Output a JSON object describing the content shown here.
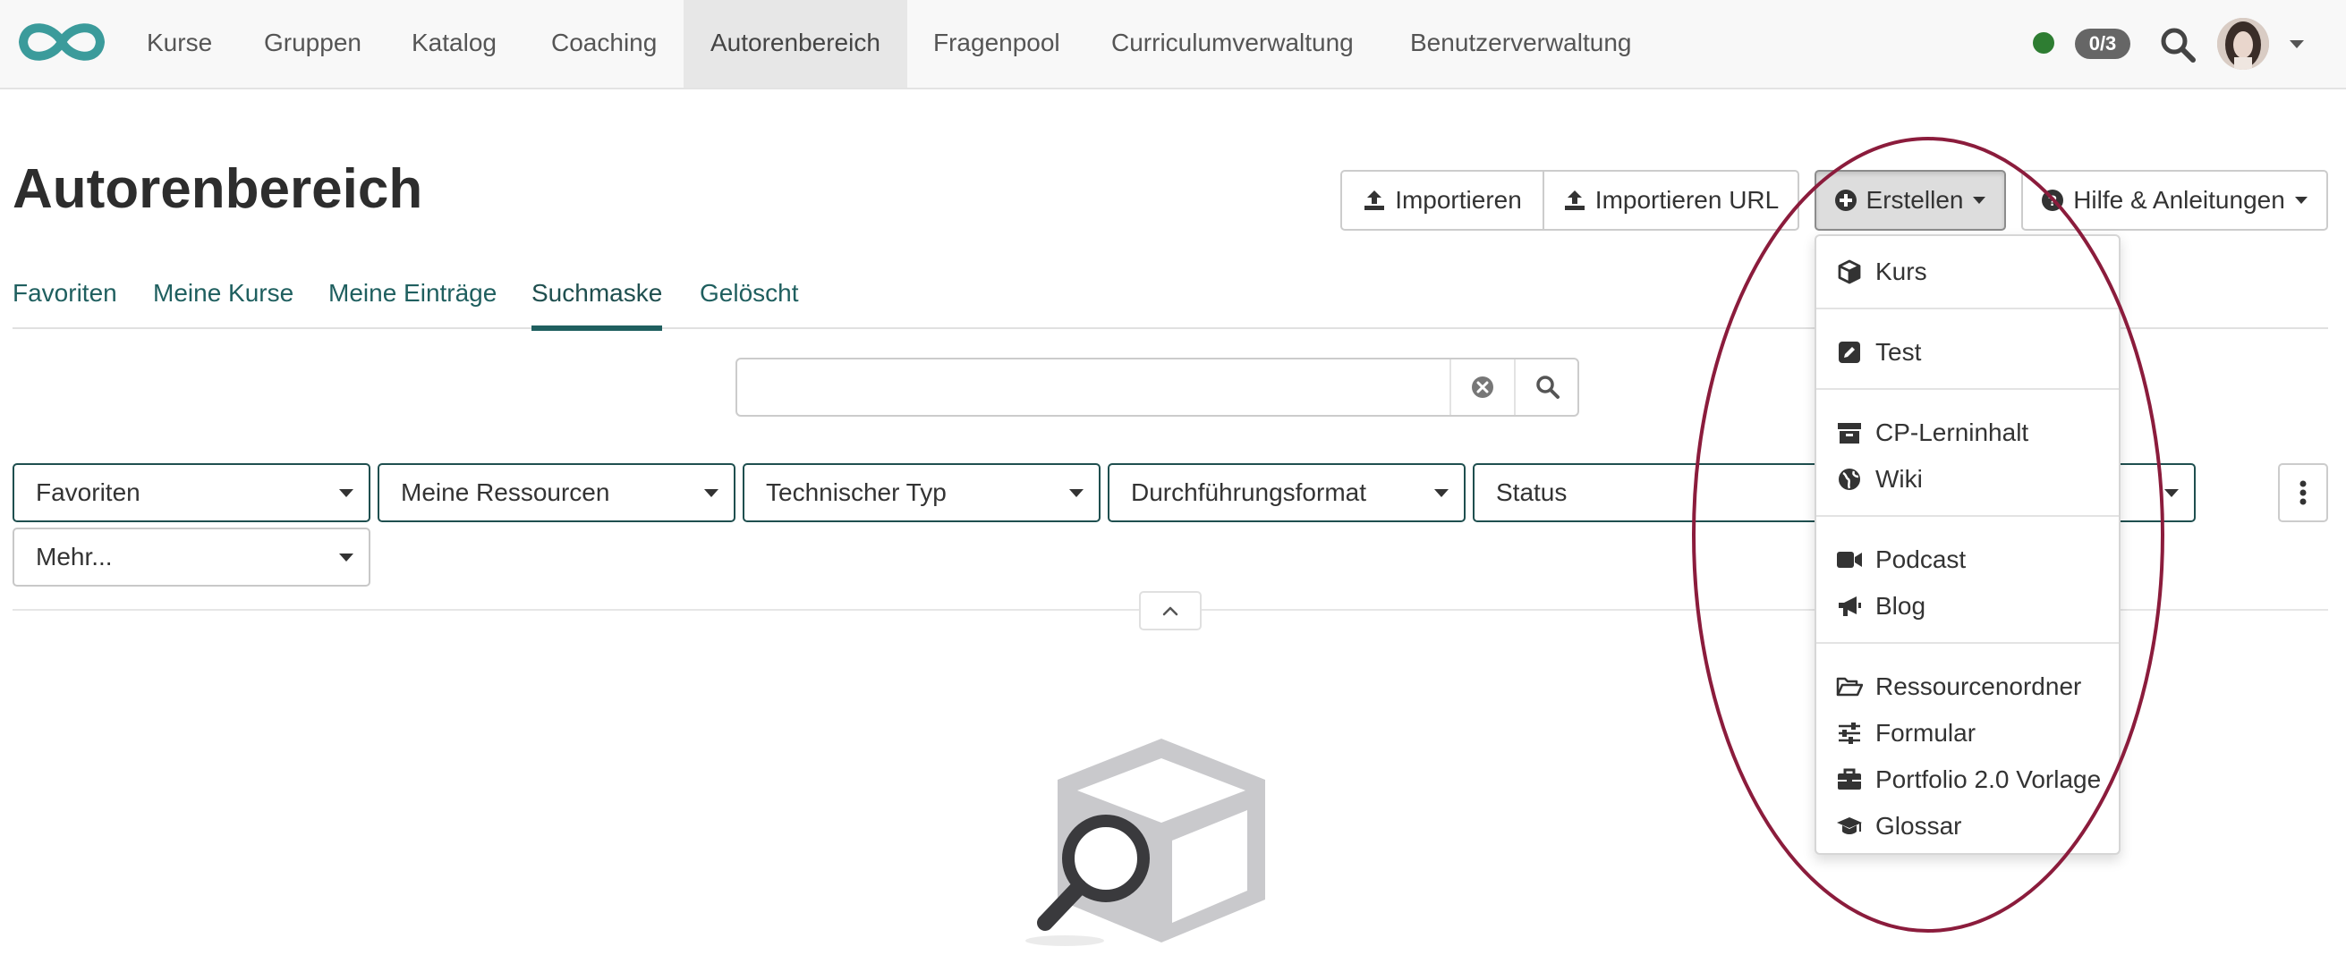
{
  "topnav": {
    "items": [
      {
        "label": "Kurse"
      },
      {
        "label": "Gruppen"
      },
      {
        "label": "Katalog"
      },
      {
        "label": "Coaching"
      },
      {
        "label": "Autorenbereich",
        "active": true
      },
      {
        "label": "Fragenpool"
      },
      {
        "label": "Curriculumverwaltung"
      },
      {
        "label": "Benutzerverwaltung"
      }
    ],
    "online_count": "0/3",
    "status_color": "#2e7d32",
    "logo_color": "#3b9b9b"
  },
  "page": {
    "title": "Autorenbereich"
  },
  "toolbar": {
    "import_label": "Importieren",
    "import_url_label": "Importieren URL",
    "create_label": "Erstellen",
    "help_label": "Hilfe & Anleitungen"
  },
  "tabs": [
    {
      "label": "Favoriten"
    },
    {
      "label": "Meine Kurse"
    },
    {
      "label": "Meine Einträge"
    },
    {
      "label": "Suchmaske",
      "active": true
    },
    {
      "label": "Gelöscht"
    }
  ],
  "search": {
    "value": "",
    "placeholder": ""
  },
  "filters": [
    {
      "label": "Favoriten"
    },
    {
      "label": "Meine Ressourcen"
    },
    {
      "label": "Technischer Typ"
    },
    {
      "label": "Durchführungsformat"
    },
    {
      "label": "Status"
    },
    {
      "label": "Mehr..."
    }
  ],
  "create_menu": {
    "items": [
      {
        "label": "Kurs",
        "icon": "cube-icon"
      },
      {
        "label": "Test",
        "icon": "edit-icon"
      },
      {
        "label": "CP-Lerninhalt",
        "icon": "archive-icon"
      },
      {
        "label": "Wiki",
        "icon": "globe-icon"
      },
      {
        "label": "Podcast",
        "icon": "video-icon"
      },
      {
        "label": "Blog",
        "icon": "megaphone-icon"
      },
      {
        "label": "Ressourcenordner",
        "icon": "folder-open-icon"
      },
      {
        "label": "Formular",
        "icon": "sliders-icon"
      },
      {
        "label": "Portfolio 2.0 Vorlage",
        "icon": "briefcase-icon"
      },
      {
        "label": "Glossar",
        "icon": "graduation-cap-icon"
      }
    ]
  },
  "colors": {
    "accent": "#1f5f5f",
    "annotation": "#8b1c3c"
  }
}
